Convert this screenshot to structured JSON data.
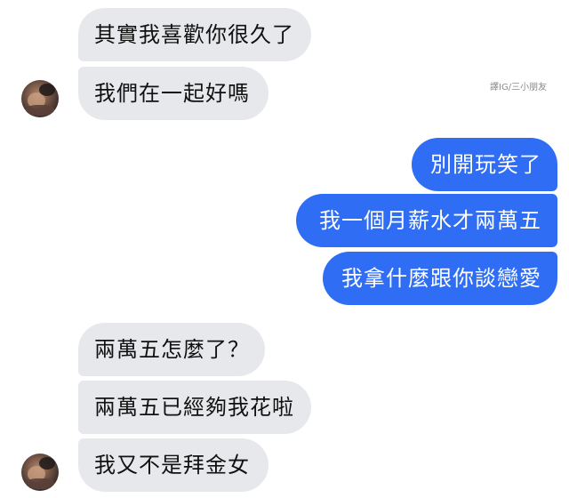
{
  "watermark": "譯IG/三小朋友",
  "messages": [
    {
      "side": "incoming",
      "text": "其實我喜歡你很久了"
    },
    {
      "side": "incoming",
      "text": "我們在一起好嗎"
    },
    {
      "side": "outgoing",
      "text": "別開玩笑了"
    },
    {
      "side": "outgoing",
      "text": "我一個月薪水才兩萬五"
    },
    {
      "side": "outgoing",
      "text": "我拿什麼跟你談戀愛"
    },
    {
      "side": "incoming",
      "text": "兩萬五怎麼了？"
    },
    {
      "side": "incoming",
      "text": "兩萬五已經夠我花啦"
    },
    {
      "side": "incoming",
      "text": "我又不是拜金女"
    }
  ],
  "colors": {
    "incoming_bubble": "#e6e8eb",
    "outgoing_bubble": "#2f6df4",
    "incoming_text": "#111111",
    "outgoing_text": "#ffffff",
    "background": "#ffffff"
  },
  "icons": {
    "sender_avatar": "avatar-photo-icon"
  }
}
